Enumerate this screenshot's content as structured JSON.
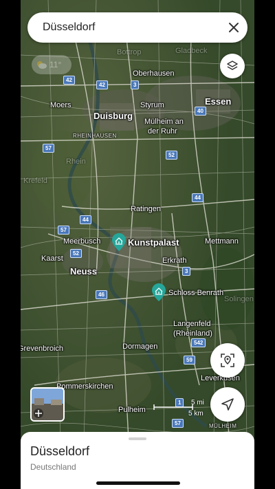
{
  "search": {
    "value": "Düsseldorf"
  },
  "weather": {
    "temp": "11°"
  },
  "places": {
    "essen": "Essen",
    "oberhausen": "Oberhausen",
    "moers": "Moers",
    "duisburg": "Duisburg",
    "styrum": "Styrum",
    "muelheim1": "Mülheim an",
    "muelheim2": "der Ruhr",
    "rheinhausen": "RHEINHAUSEN",
    "rhein": "Rhein",
    "krefeld": "Krefeld",
    "ratingen": "Ratingen",
    "meerbusch": "Meerbusch",
    "kunstpalast": "Kunstpalast",
    "mettmann": "Mettmann",
    "kaarst": "Kaarst",
    "erkrath": "Erkrath",
    "neuss": "Neuss",
    "schloss": "Schloss Benrath",
    "solingen": "Solingen",
    "langenfeld1": "Langenfeld",
    "langenfeld2": "(Rheinland)",
    "grevenbroich": "Grevenbroich",
    "dormagen": "Dormagen",
    "leverkusen": "Leverkusen",
    "pommerskirchen": "Pommerskirchen",
    "pulheim": "Pulheim",
    "muelheim_small": "MÜLHEIM",
    "bottrop": "Bottrop",
    "gladbeck": "Gladbeck"
  },
  "shields": {
    "s42a": "42",
    "s42b": "42",
    "s3a": "3",
    "s40": "40",
    "s57a": "57",
    "s52a": "52",
    "s44a": "44",
    "s44b": "44",
    "s57b": "57",
    "s52b": "52",
    "s3b": "3",
    "s46": "46",
    "s542": "542",
    "s59": "59",
    "s1": "1",
    "s57c": "57"
  },
  "scale": {
    "miles": "5 mi",
    "km": "5 km"
  },
  "sheet": {
    "title": "Düsseldorf",
    "subtitle": "Deutschland"
  },
  "colors": {
    "pin": "#26a69a",
    "shield": "#4a78b8",
    "map_base": "#3d5130"
  }
}
